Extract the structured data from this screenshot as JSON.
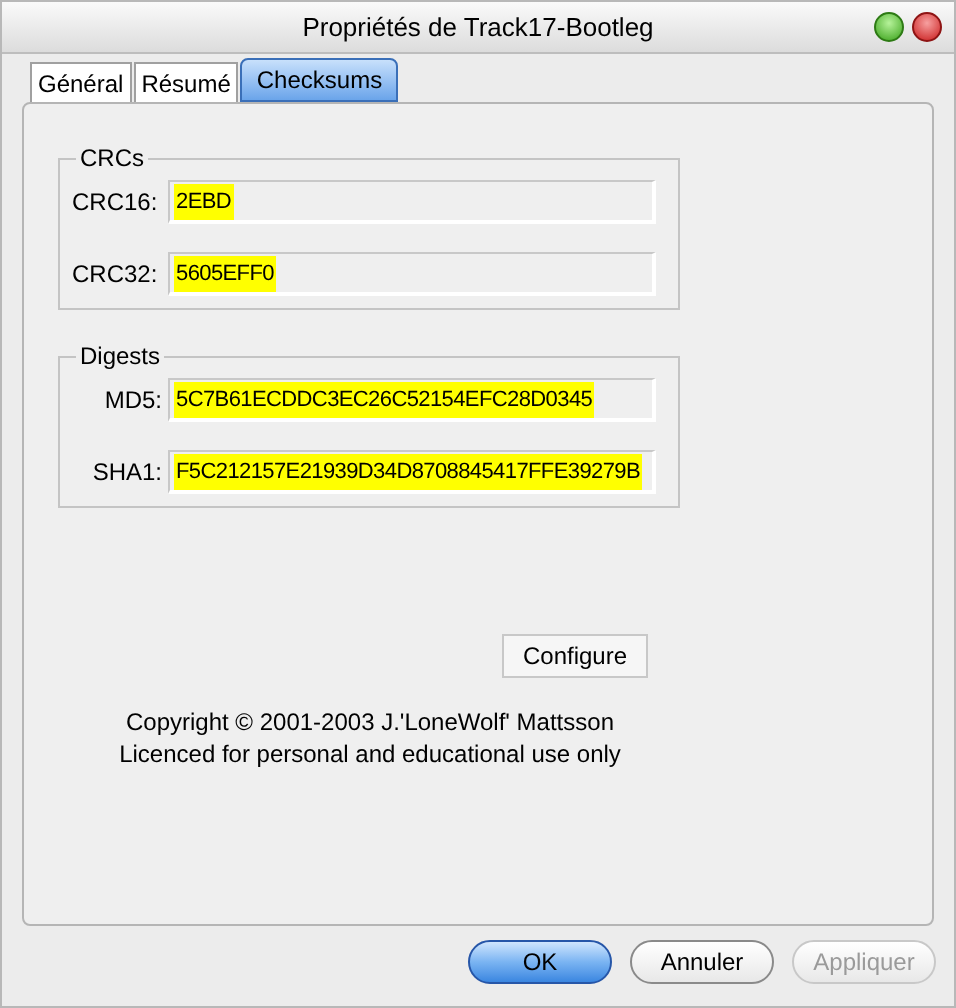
{
  "window": {
    "title": "Propriétés de Track17-Bootleg"
  },
  "tabs": [
    {
      "label": "Général",
      "selected": false
    },
    {
      "label": "Résumé",
      "selected": false
    },
    {
      "label": "Checksums",
      "selected": true
    }
  ],
  "groups": [
    {
      "title": "CRCs",
      "fields": [
        {
          "label": "CRC16:",
          "value": "2EBD",
          "highlighted": true
        },
        {
          "label": "CRC32:",
          "value": "5605EFF0",
          "highlighted": true
        }
      ]
    },
    {
      "title": "Digests",
      "fields": [
        {
          "label": "MD5:",
          "value": "5C7B61ECDDC3EC26C52154EFC28D0345",
          "highlighted": true
        },
        {
          "label": "SHA1:",
          "value": "F5C212157E21939D34D8708845417FFE39279B",
          "highlighted": true
        }
      ]
    }
  ],
  "configure_button": "Configure",
  "copyright": [
    "Copyright © 2001-2003 J.'LoneWolf' Mattsson",
    "Licenced for personal and educational use only"
  ],
  "buttons": [
    {
      "label": "OK",
      "kind": "default",
      "disabled": false
    },
    {
      "label": "Annuler",
      "kind": "normal",
      "disabled": false
    },
    {
      "label": "Appliquer",
      "kind": "normal",
      "disabled": true
    }
  ]
}
